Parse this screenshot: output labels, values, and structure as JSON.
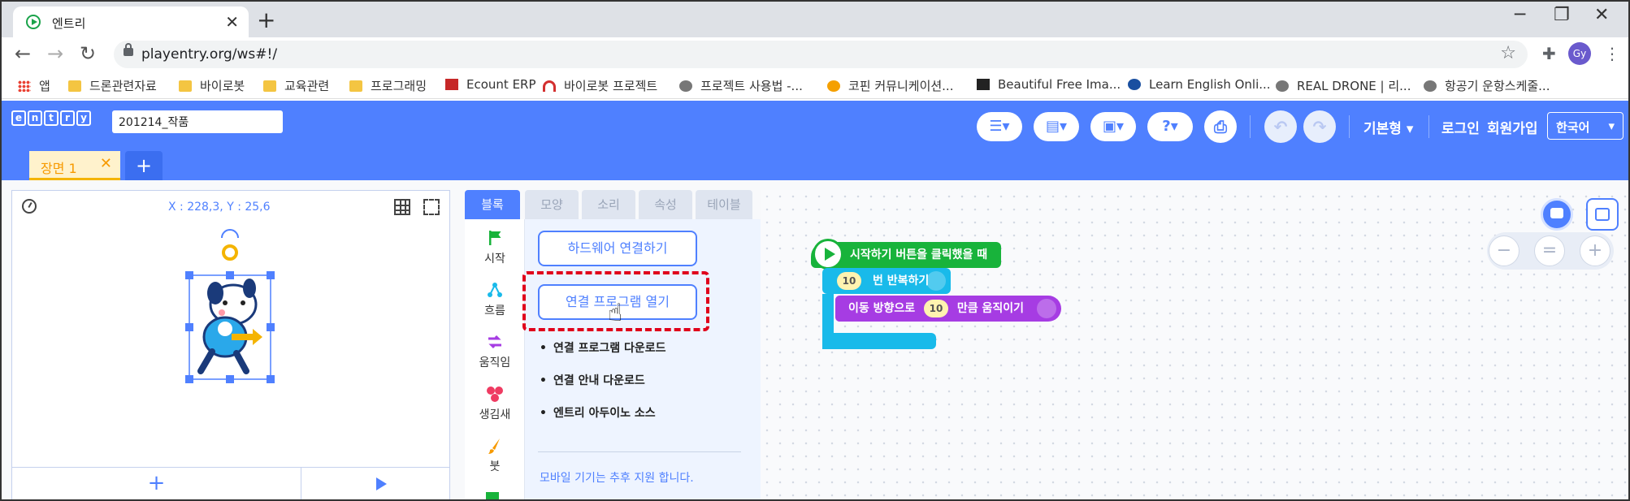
{
  "browser": {
    "tab_title": "엔트리",
    "url": "playentry.org/ws#!/",
    "profile_initials": "Gy",
    "bookmarks": [
      "앱",
      "드론관련자료",
      "바이로봇",
      "교육관련",
      "프로그래밍",
      "Ecount ERP",
      "바이로봇 프로젝트",
      "프로젝트 사용법 -...",
      "코핀 커뮤니케이션...",
      "Beautiful Free Ima...",
      "Learn English Onli...",
      "REAL DRONE | 리...",
      "항공기 운항스케줄..."
    ]
  },
  "entry": {
    "logo_letters": [
      "e",
      "n",
      "t",
      "r",
      "y"
    ],
    "project_name": "201214_작품",
    "mode_label": "기본형",
    "login_label": "로그인",
    "signup_label": "회원가입",
    "language": "한국어",
    "scene_tab": "장면 1",
    "coords": "X : 228,3,  Y : 25,6",
    "block_tabs": [
      "블록",
      "모양",
      "소리",
      "속성",
      "테이블"
    ],
    "categories": [
      "시작",
      "흐름",
      "움직임",
      "생김새",
      "붓"
    ],
    "hardware_connect": "하드웨어 연결하기",
    "open_connector": "연결 프로그램 열기",
    "links": [
      "연결 프로그램 다운로드",
      "연결 안내 다운로드",
      "엔트리 아두이노 소스"
    ],
    "mobile_note": "모바일 기기는 추후 지원 합니다.",
    "blocks": {
      "start": "시작하기 버튼을 클릭했을 때",
      "repeat_count": "10",
      "repeat_label": "번 반복하기",
      "move_prefix": "이동 방향으로",
      "move_count": "10",
      "move_suffix": "만큼 움직이기"
    }
  },
  "colors": {
    "entry_blue": "#4f80ff",
    "start_green": "#18b33b",
    "flow_cyan": "#19baea",
    "move_purple": "#a63ce3",
    "highlight_red": "#e0001b"
  }
}
